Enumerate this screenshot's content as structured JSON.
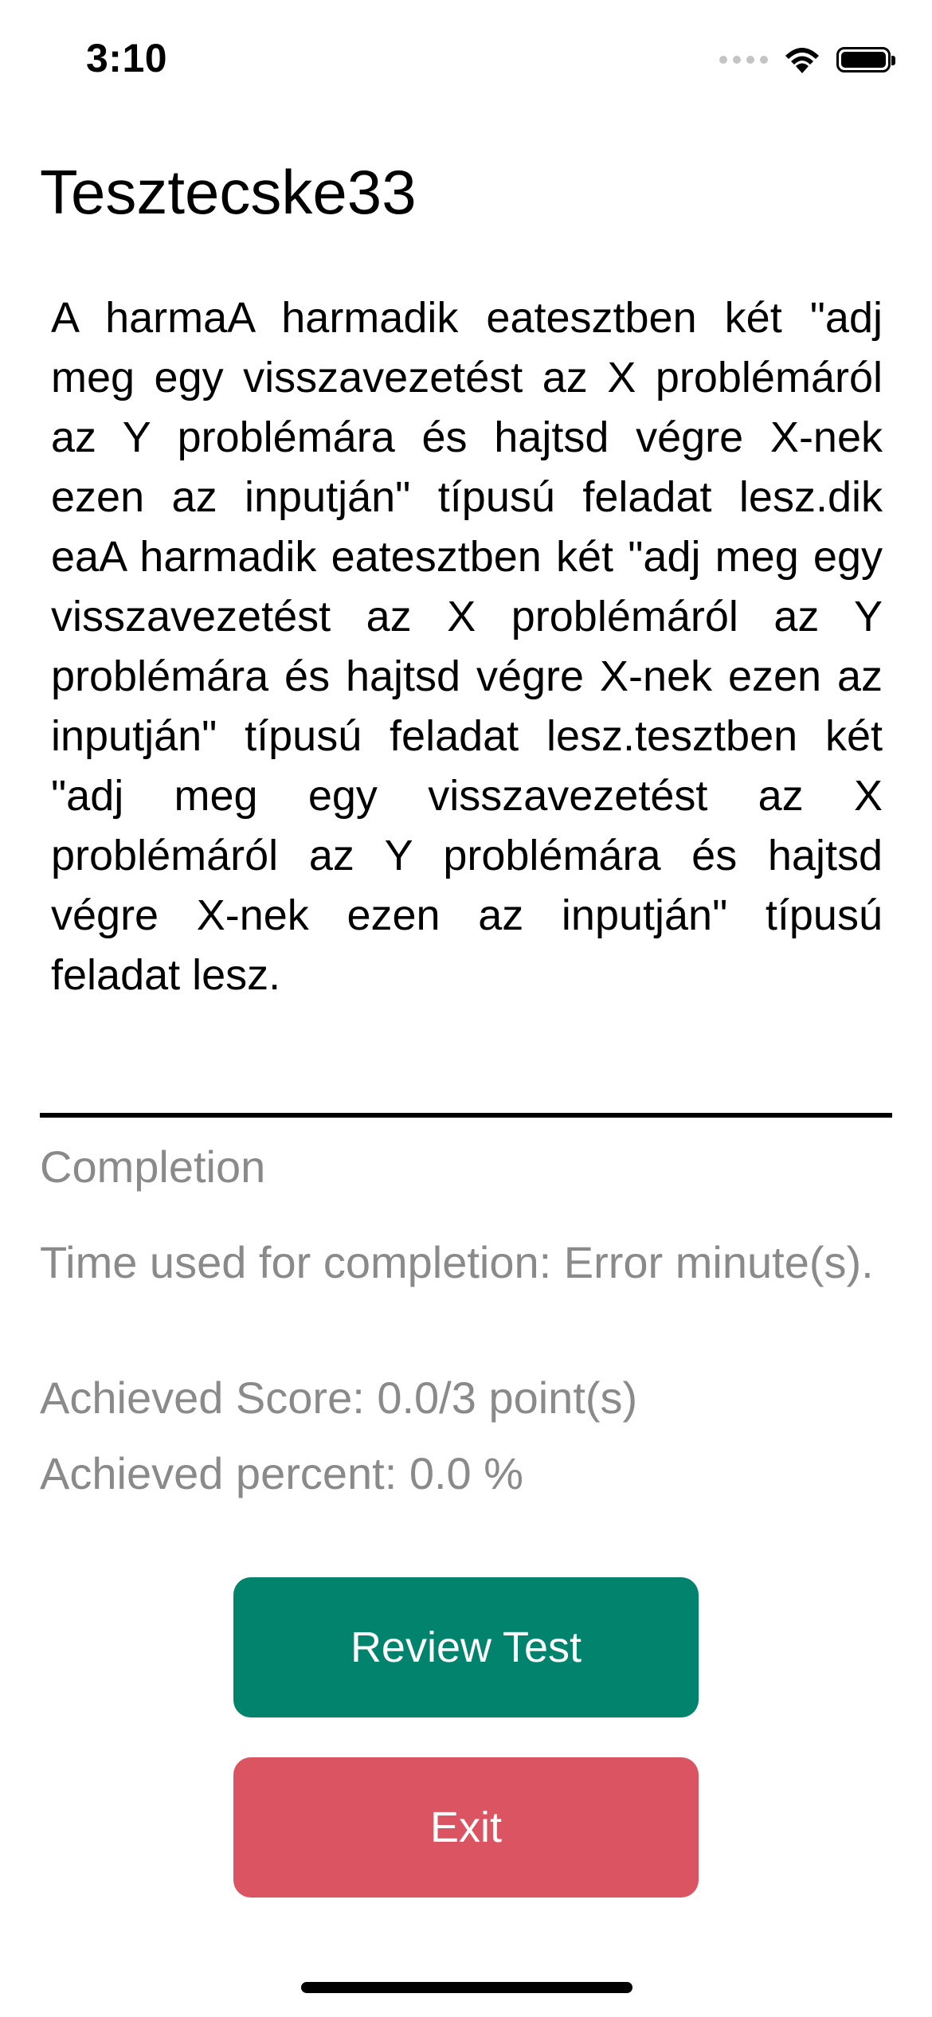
{
  "status_bar": {
    "time": "3:10"
  },
  "page": {
    "title": "Tesztecske33",
    "description": "A harmaA harmadik eatesztben két \"adj meg egy visszavezetést az X problémáról az Y problémára és hajtsd végre X-nek ezen az inputján\" típusú feladat lesz.dik eaA harmadik eatesztben két \"adj meg egy visszavezetést az X problémáról az Y problémára és hajtsd végre X-nek ezen az inputján\" típusú feladat lesz.tesztben két \"adj meg egy visszavezetést az X problémáról az Y problémára és hajtsd végre X-nek ezen az inputján\" típusú feladat lesz."
  },
  "completion": {
    "heading": "Completion",
    "time_used": "Time used for completion: Error minute(s).",
    "score": "Achieved Score: 0.0/3 point(s)",
    "percent": "Achieved percent: 0.0 %"
  },
  "buttons": {
    "review_label": "Review Test",
    "exit_label": "Exit"
  },
  "colors": {
    "review": "#02836d",
    "exit": "#db5461",
    "muted_text": "#8a8a8a"
  }
}
